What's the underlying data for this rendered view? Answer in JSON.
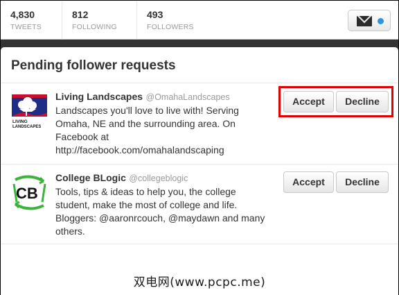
{
  "stats": [
    {
      "count": "4,830",
      "label": "TWEETS"
    },
    {
      "count": "812",
      "label": "FOLLOWING"
    },
    {
      "count": "493",
      "label": "FOLLOWERS"
    }
  ],
  "messages": {
    "icon": "envelope-icon",
    "unread_indicator_color": "#2b95e0"
  },
  "panel": {
    "title": "Pending follower requests"
  },
  "requests": [
    {
      "name": "Living Landscapes",
      "handle": "@OmahaLandscapes",
      "bio": "Landscapes you'll love to live with! Serving Omaha, NE and the surrounding area. On Facebook at http://facebook.com/omahalandscaping",
      "accept_label": "Accept",
      "decline_label": "Decline",
      "avatar_text": "LIVING LANDSCAPES"
    },
    {
      "name": "College BLogic",
      "handle": "@collegeblogic",
      "bio": "Tools, tips & ideas to help you, the college student, make the most of college and life. Bloggers: @aaronrcouch, @maydawn and many others.",
      "accept_label": "Accept",
      "decline_label": "Decline",
      "avatar_text": "CB"
    }
  ],
  "highlight_color": "#e00000",
  "watermark": "双电网(www.pcpc.me)"
}
